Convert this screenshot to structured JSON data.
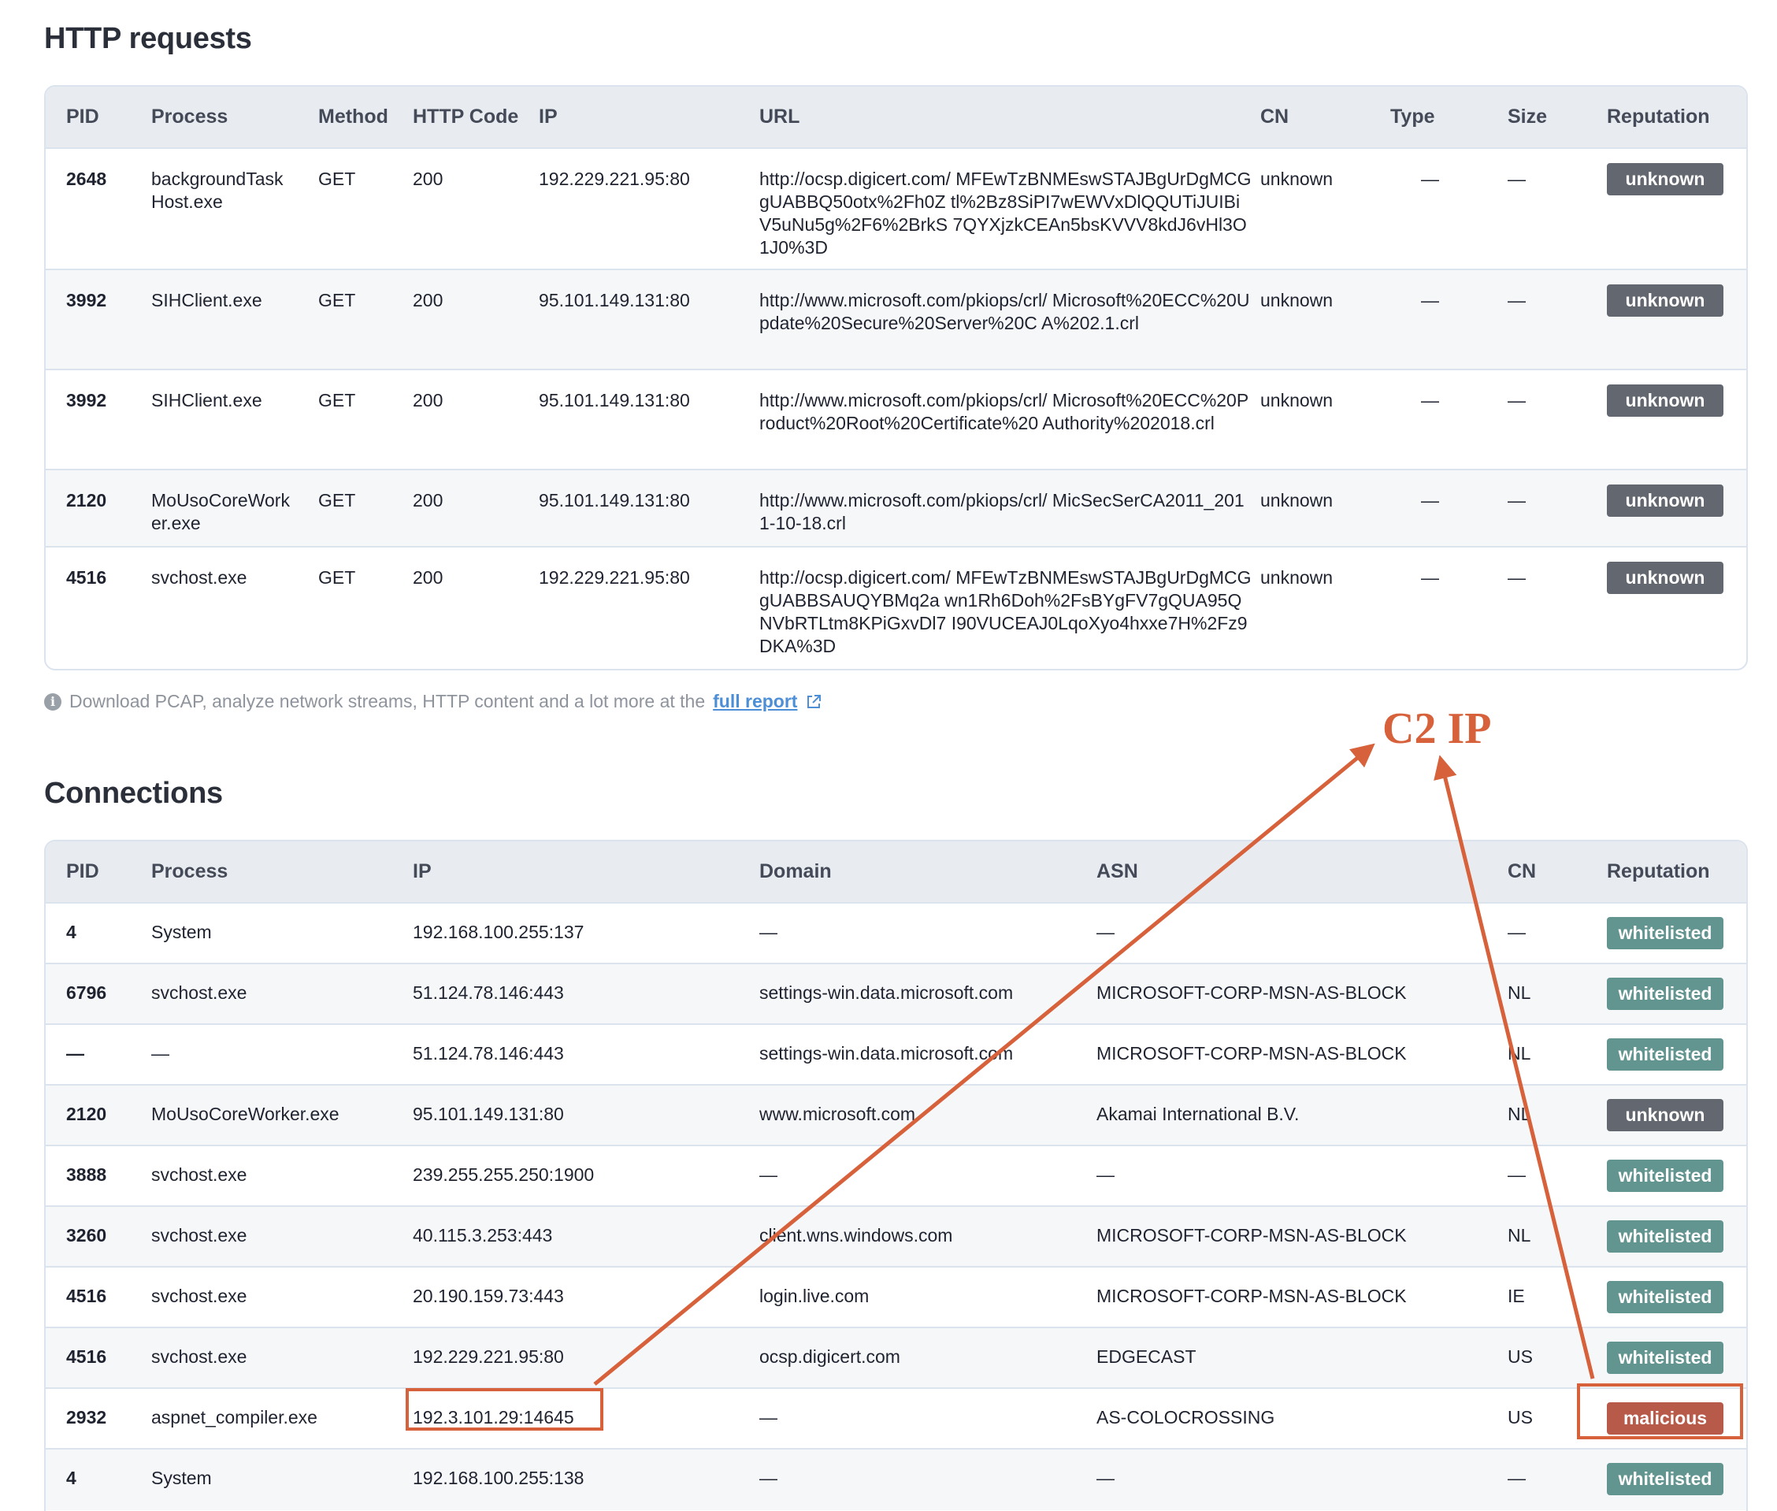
{
  "http_requests": {
    "title": "HTTP requests",
    "columns": [
      "PID",
      "Process",
      "Method",
      "HTTP Code",
      "IP",
      "URL",
      "CN",
      "Type",
      "Size",
      "Reputation"
    ],
    "rows": [
      {
        "pid": "2648",
        "process": "backgroundTask Host.exe",
        "method": "GET",
        "code": "200",
        "ip": "192.229.221.95:80",
        "url": "http://ocsp.digicert.com/ MFEwTzBNMEswSTAJBgUrDgMCGgUABBQ50otx%2Fh0Z tl%2Bz8SiPI7wEWVxDlQQUTiJUIBiV5uNu5g%2F6%2BrkS 7QYXjzkCEAn5bsKVVV8kdJ6vHl3O1J0%3D",
        "cn": "unknown",
        "type": "—",
        "size": "—",
        "reputation": "unknown"
      },
      {
        "pid": "3992",
        "process": "SIHClient.exe",
        "method": "GET",
        "code": "200",
        "ip": "95.101.149.131:80",
        "url": "http://www.microsoft.com/pkiops/crl/ Microsoft%20ECC%20Update%20Secure%20Server%20C A%202.1.crl",
        "cn": "unknown",
        "type": "—",
        "size": "—",
        "reputation": "unknown"
      },
      {
        "pid": "3992",
        "process": "SIHClient.exe",
        "method": "GET",
        "code": "200",
        "ip": "95.101.149.131:80",
        "url": "http://www.microsoft.com/pkiops/crl/ Microsoft%20ECC%20Product%20Root%20Certificate%20 Authority%202018.crl",
        "cn": "unknown",
        "type": "—",
        "size": "—",
        "reputation": "unknown"
      },
      {
        "pid": "2120",
        "process": "MoUsoCoreWork er.exe",
        "method": "GET",
        "code": "200",
        "ip": "95.101.149.131:80",
        "url": "http://www.microsoft.com/pkiops/crl/ MicSecSerCA2011_2011-10-18.crl",
        "cn": "unknown",
        "type": "—",
        "size": "—",
        "reputation": "unknown"
      },
      {
        "pid": "4516",
        "process": "svchost.exe",
        "method": "GET",
        "code": "200",
        "ip": "192.229.221.95:80",
        "url": "http://ocsp.digicert.com/ MFEwTzBNMEswSTAJBgUrDgMCGgUABBSAUQYBMq2a wn1Rh6Doh%2FsBYgFV7gQUA95QNVbRTLtm8KPiGxvDl7 I90VUCEAJ0LqoXyo4hxxe7H%2Fz9DKA%3D",
        "cn": "unknown",
        "type": "—",
        "size": "—",
        "reputation": "unknown"
      }
    ]
  },
  "info": {
    "text": "Download PCAP, analyze network streams, HTTP content and a lot more at the",
    "link_label": "full report",
    "icon": "info-icon",
    "link_icon": "external-link-icon"
  },
  "connections": {
    "title": "Connections",
    "columns": [
      "PID",
      "Process",
      "IP",
      "Domain",
      "ASN",
      "CN",
      "Reputation"
    ],
    "rows": [
      {
        "pid": "4",
        "process": "System",
        "ip": "192.168.100.255:137",
        "domain": "—",
        "asn": "—",
        "cn": "—",
        "reputation": "whitelisted"
      },
      {
        "pid": "6796",
        "process": "svchost.exe",
        "ip": "51.124.78.146:443",
        "domain": "settings-win.data.microsoft.com",
        "asn": "MICROSOFT-CORP-MSN-AS-BLOCK",
        "cn": "NL",
        "reputation": "whitelisted"
      },
      {
        "pid": "—",
        "process": "—",
        "ip": "51.124.78.146:443",
        "domain": "settings-win.data.microsoft.com",
        "asn": "MICROSOFT-CORP-MSN-AS-BLOCK",
        "cn": "NL",
        "reputation": "whitelisted"
      },
      {
        "pid": "2120",
        "process": "MoUsoCoreWorker.exe",
        "ip": "95.101.149.131:80",
        "domain": "www.microsoft.com",
        "asn": "Akamai International B.V.",
        "cn": "NL",
        "reputation": "unknown"
      },
      {
        "pid": "3888",
        "process": "svchost.exe",
        "ip": "239.255.255.250:1900",
        "domain": "—",
        "asn": "—",
        "cn": "—",
        "reputation": "whitelisted"
      },
      {
        "pid": "3260",
        "process": "svchost.exe",
        "ip": "40.115.3.253:443",
        "domain": "client.wns.windows.com",
        "asn": "MICROSOFT-CORP-MSN-AS-BLOCK",
        "cn": "NL",
        "reputation": "whitelisted"
      },
      {
        "pid": "4516",
        "process": "svchost.exe",
        "ip": "20.190.159.73:443",
        "domain": "login.live.com",
        "asn": "MICROSOFT-CORP-MSN-AS-BLOCK",
        "cn": "IE",
        "reputation": "whitelisted"
      },
      {
        "pid": "4516",
        "process": "svchost.exe",
        "ip": "192.229.221.95:80",
        "domain": "ocsp.digicert.com",
        "asn": "EDGECAST",
        "cn": "US",
        "reputation": "whitelisted"
      },
      {
        "pid": "2932",
        "process": "aspnet_compiler.exe",
        "ip": "192.3.101.29:14645",
        "domain": "—",
        "asn": "AS-COLOCROSSING",
        "cn": "US",
        "reputation": "malicious"
      },
      {
        "pid": "4",
        "process": "System",
        "ip": "192.168.100.255:138",
        "domain": "—",
        "asn": "—",
        "cn": "—",
        "reputation": "whitelisted"
      }
    ]
  },
  "annotation": {
    "label": "C2 IP",
    "color": "#d6613a",
    "highlighted_ip": "192.3.101.29:14645",
    "highlighted_reputation": "malicious"
  },
  "colors": {
    "badge_unknown": "#63676f",
    "badge_whitelisted": "#629490",
    "badge_malicious": "#b85a4a",
    "link": "#4d8fd6"
  }
}
